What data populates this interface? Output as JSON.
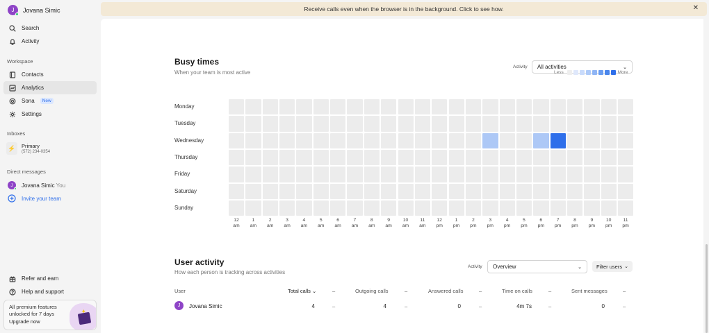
{
  "user": {
    "name": "Jovana Simic",
    "initial": "J"
  },
  "nav": {
    "search": "Search",
    "activity": "Activity",
    "workspace_label": "Workspace",
    "contacts": "Contacts",
    "analytics": "Analytics",
    "sona": "Sona",
    "sona_badge": "New",
    "settings": "Settings",
    "inboxes_label": "Inboxes",
    "inbox_title": "Primary",
    "inbox_phone": "(572) 234-0354",
    "dm_label": "Direct messages",
    "dm_name": "Jovana Simic",
    "dm_you": "You",
    "invite": "Invite your team",
    "refer": "Refer and earn",
    "help": "Help and support"
  },
  "premium": {
    "text": "All premium features unlocked for 7 days",
    "cta": "Upgrade now"
  },
  "banner": {
    "text": "Receive calls even when the browser is in the background. Click to see how.",
    "close": "✕"
  },
  "busy": {
    "title": "Busy times",
    "subtitle": "When your team is most active",
    "activity_label": "Activity",
    "activity_value": "All activities",
    "legend_less": "Less",
    "legend_more": "More",
    "legend_colors": [
      "#eeeeee",
      "#dfe8fb",
      "#c9dbfb",
      "#aecaf8",
      "#8fb5f5",
      "#6a9df1",
      "#4a86ec",
      "#2f6fea"
    ],
    "days": [
      "Monday",
      "Tuesday",
      "Wednesday",
      "Thursday",
      "Friday",
      "Saturday",
      "Sunday"
    ],
    "hours": [
      [
        "12",
        "am"
      ],
      [
        "1",
        "am"
      ],
      [
        "2",
        "am"
      ],
      [
        "3",
        "am"
      ],
      [
        "4",
        "am"
      ],
      [
        "5",
        "am"
      ],
      [
        "6",
        "am"
      ],
      [
        "7",
        "am"
      ],
      [
        "8",
        "am"
      ],
      [
        "9",
        "am"
      ],
      [
        "10",
        "am"
      ],
      [
        "11",
        "am"
      ],
      [
        "12",
        "pm"
      ],
      [
        "1",
        "pm"
      ],
      [
        "2",
        "pm"
      ],
      [
        "3",
        "pm"
      ],
      [
        "4",
        "pm"
      ],
      [
        "5",
        "pm"
      ],
      [
        "6",
        "pm"
      ],
      [
        "7",
        "pm"
      ],
      [
        "8",
        "pm"
      ],
      [
        "9",
        "pm"
      ],
      [
        "10",
        "pm"
      ],
      [
        "11",
        "pm"
      ]
    ],
    "highlights": [
      {
        "day": 2,
        "hour": 15,
        "level": 0.35
      },
      {
        "day": 2,
        "hour": 18,
        "level": 0.35
      },
      {
        "day": 2,
        "hour": 19,
        "level": 1.0
      }
    ],
    "cell_color": "#ececec",
    "low_color": "#adc8f6",
    "high_color": "#2f6fea"
  },
  "user_activity": {
    "title": "User activity",
    "subtitle": "How each person is tracking across activities",
    "activity_label": "Activity",
    "activity_value": "Overview",
    "filter": "Filter users",
    "columns": [
      "User",
      "Total calls",
      "Outgoing calls",
      "Answered calls",
      "Time on calls",
      "Sent messages"
    ],
    "dash": "–",
    "row": {
      "initial": "J",
      "name": "Jovana Simic",
      "total_calls": "4",
      "outgoing_calls": "4",
      "answered_calls": "0",
      "time_on_calls": "4m 7s",
      "sent_messages": "0"
    }
  }
}
